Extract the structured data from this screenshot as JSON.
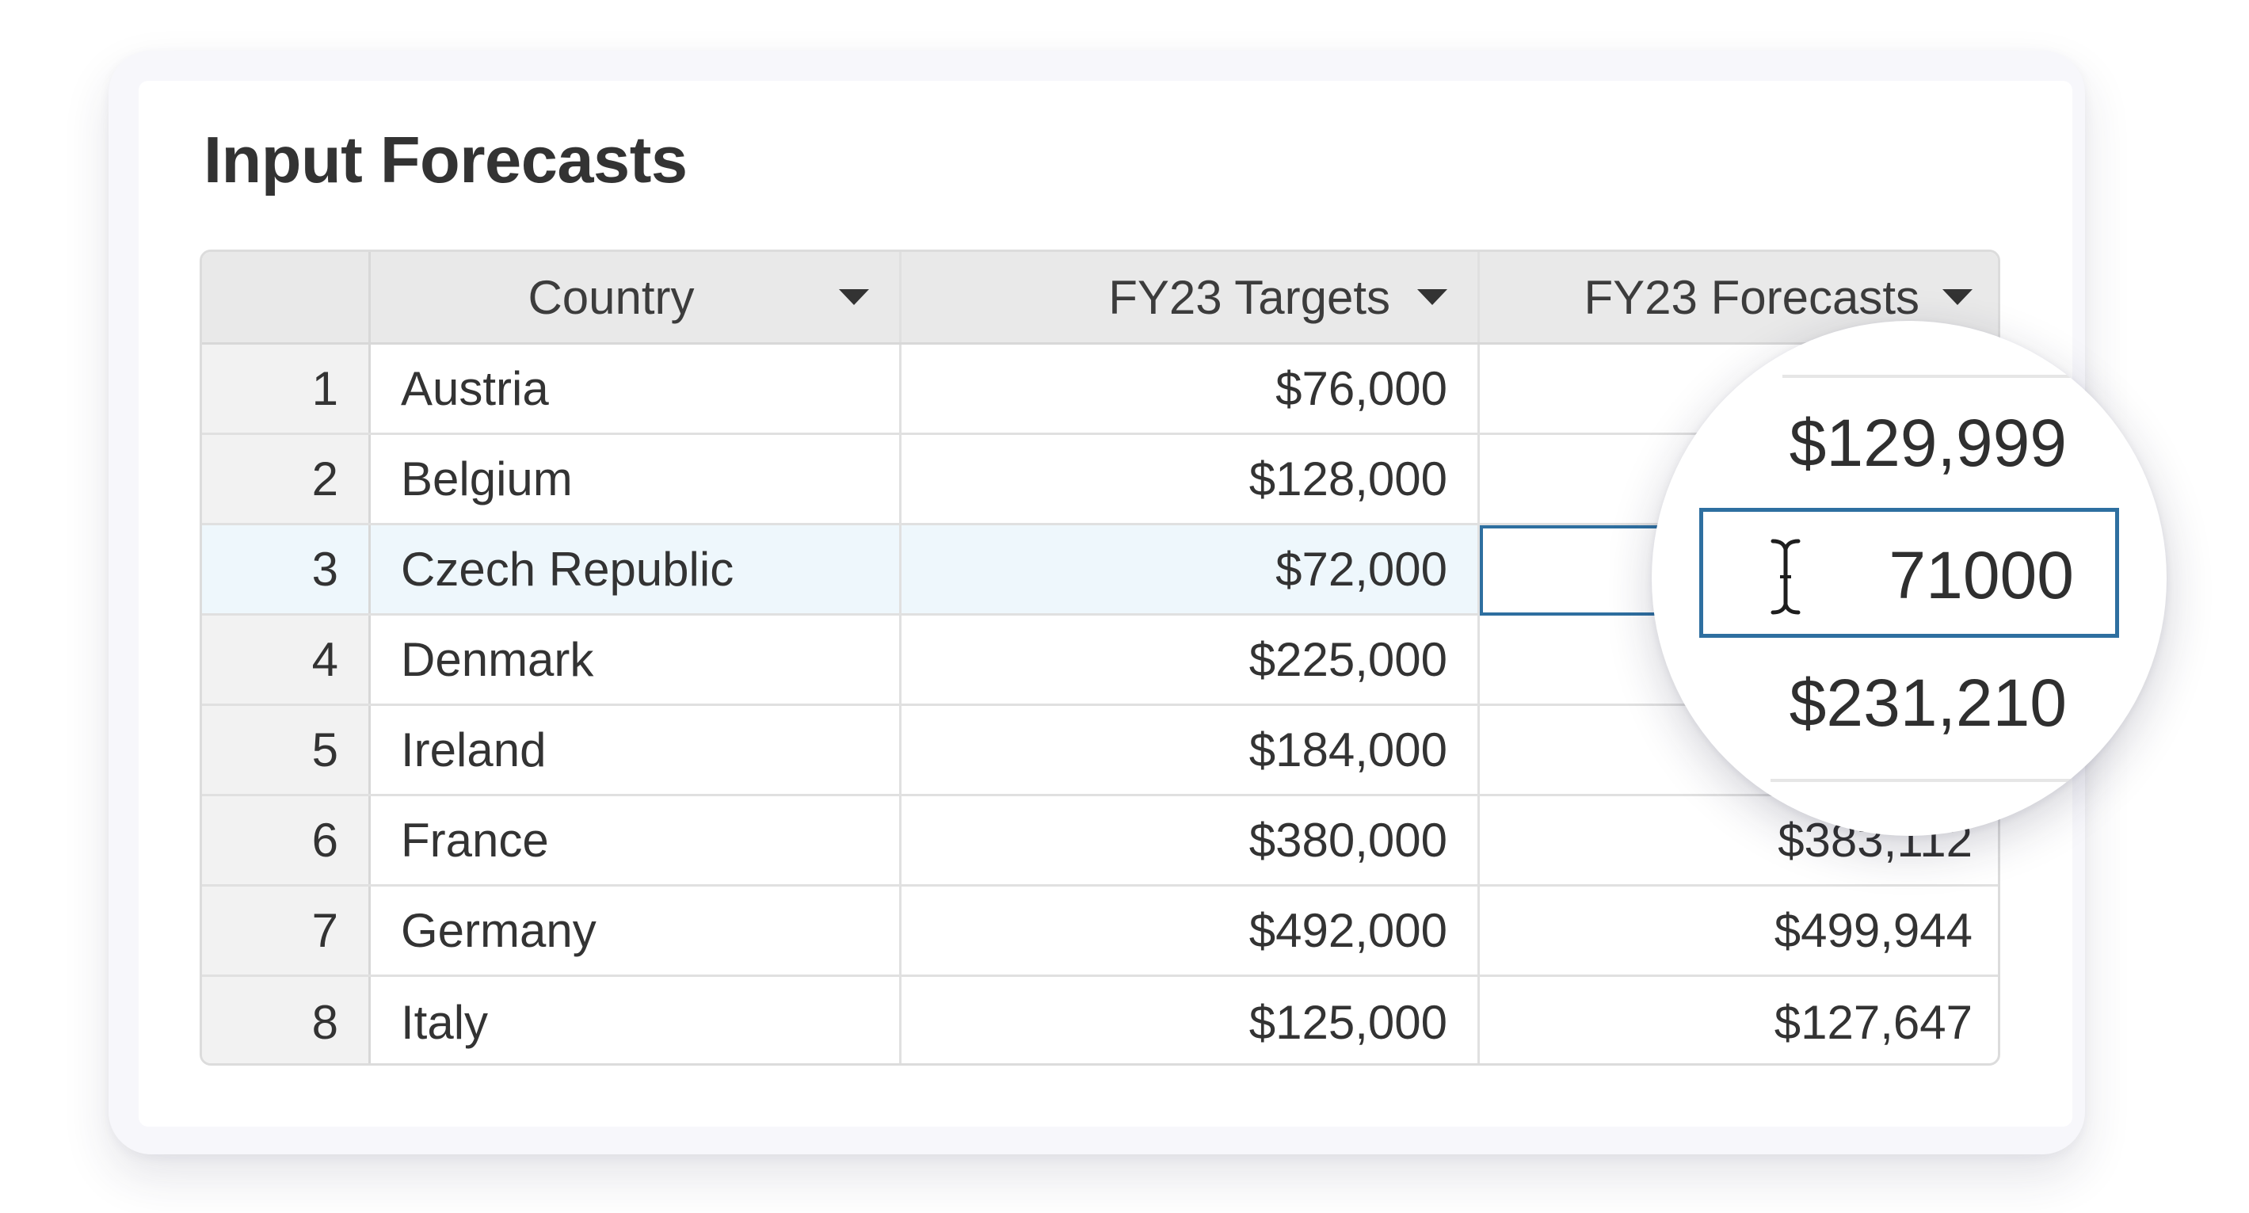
{
  "page": {
    "title": "Input Forecasts"
  },
  "table": {
    "headers": {
      "country": "Country",
      "targets": "FY23 Targets",
      "forecasts": "FY23 Forecasts"
    },
    "rows": [
      {
        "num": "1",
        "country": "Austria",
        "target": "$76,000",
        "forecast": ""
      },
      {
        "num": "2",
        "country": "Belgium",
        "target": "$128,000",
        "forecast": "$129,999"
      },
      {
        "num": "3",
        "country": "Czech Republic",
        "target": "$72,000",
        "forecast": "71000"
      },
      {
        "num": "4",
        "country": "Denmark",
        "target": "$225,000",
        "forecast": "$231,210"
      },
      {
        "num": "5",
        "country": "Ireland",
        "target": "$184,000",
        "forecast": ""
      },
      {
        "num": "6",
        "country": "France",
        "target": "$380,000",
        "forecast": "$383,112"
      },
      {
        "num": "7",
        "country": "Germany",
        "target": "$492,000",
        "forecast": "$499,944"
      },
      {
        "num": "8",
        "country": "Italy",
        "target": "$125,000",
        "forecast": "$127,647"
      }
    ],
    "selected_row": 3
  },
  "magnifier": {
    "value_above": "$129,999",
    "editing_value": "71000",
    "value_below": "$231,210"
  },
  "colors": {
    "accent": "#2e6fa0",
    "selected_row_bg": "#eef7fc",
    "header_bg": "#e9e9e9"
  },
  "icons": {
    "sort": "caret-down-icon",
    "cursor": "text-cursor-icon"
  }
}
